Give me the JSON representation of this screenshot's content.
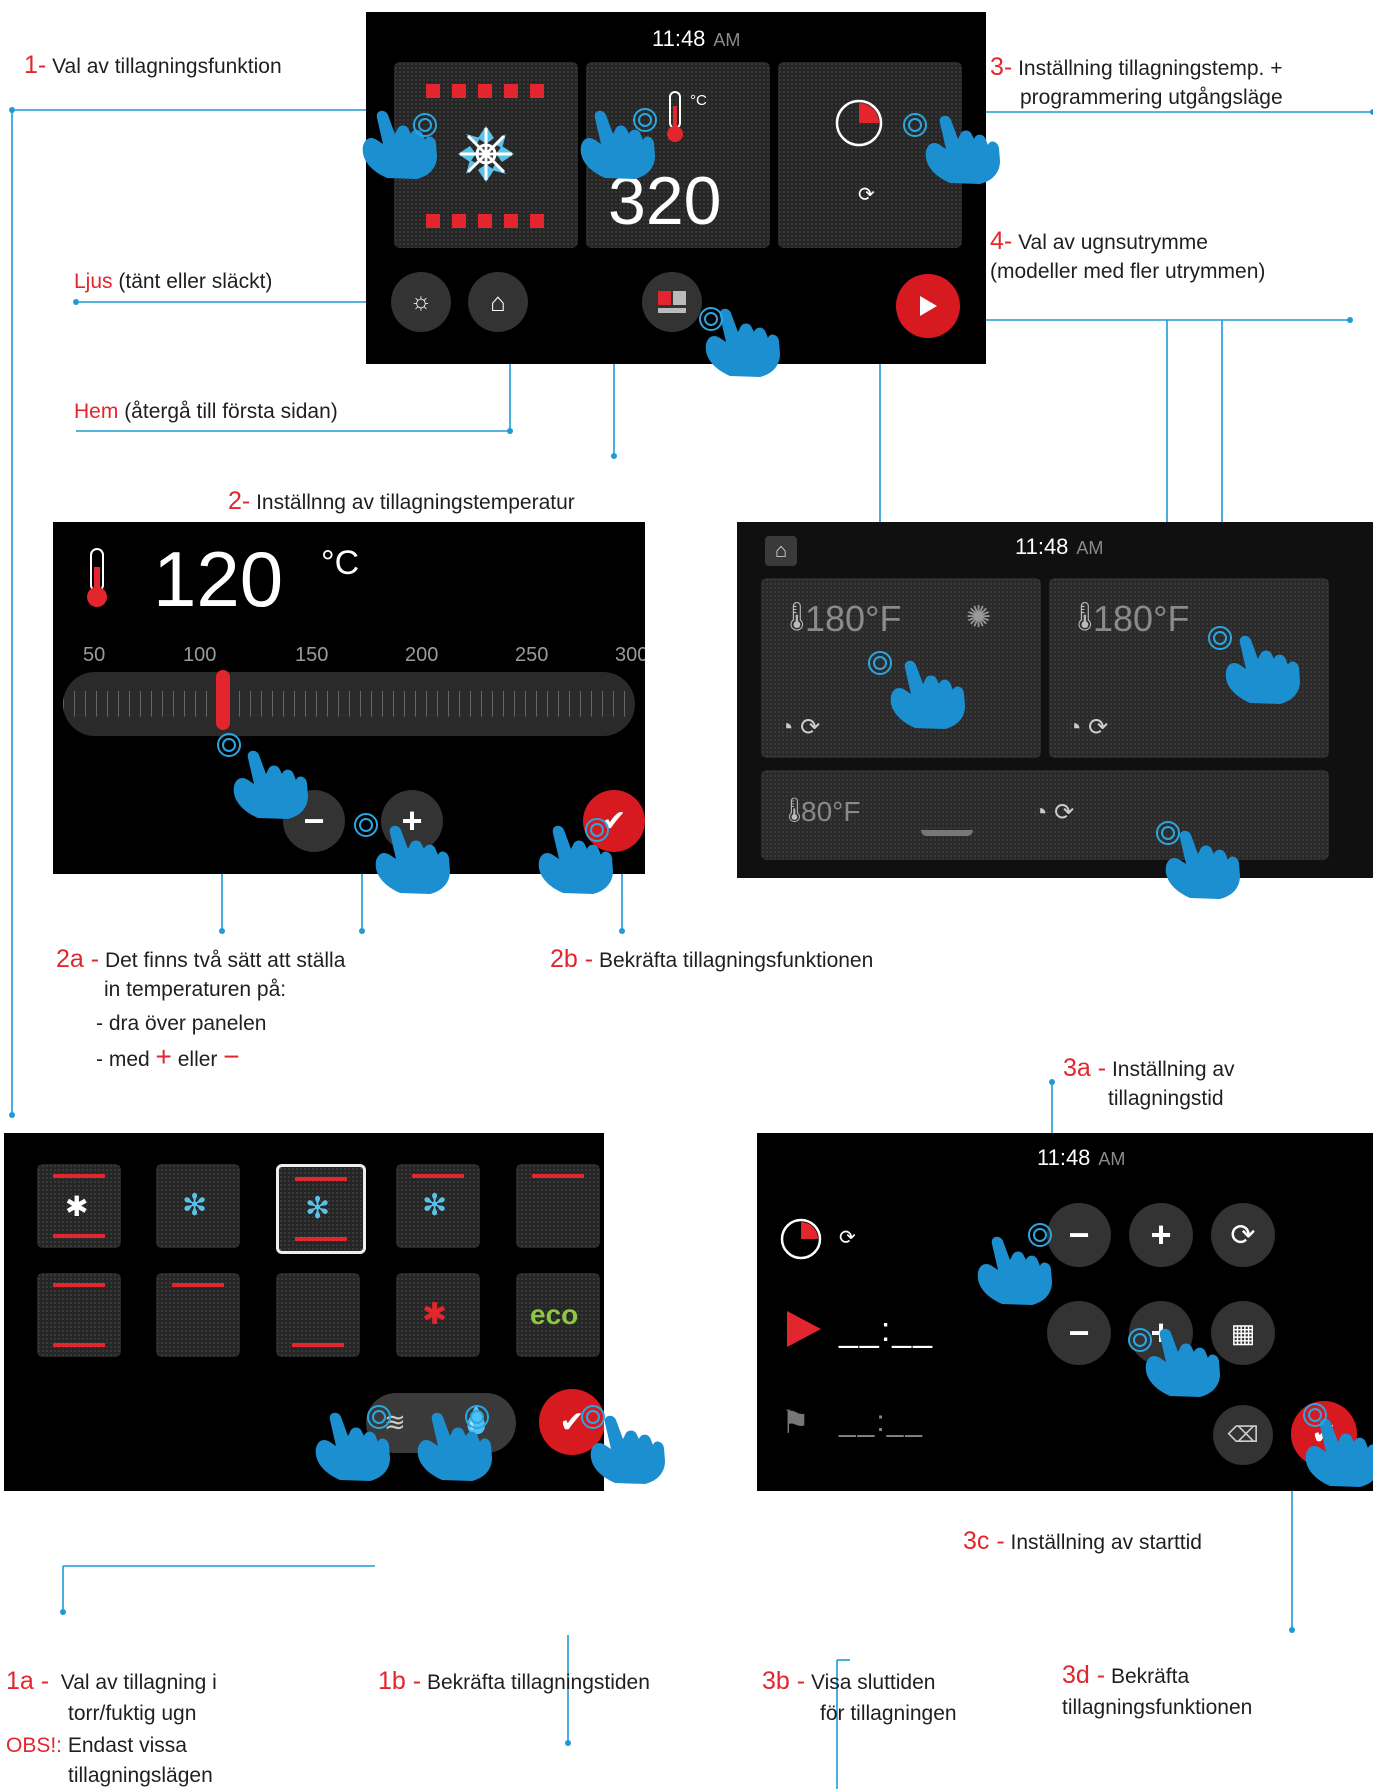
{
  "top_screen": {
    "time": "11:48",
    "ampm": "AM",
    "temperature": "320",
    "unit": "°C"
  },
  "temp_screen": {
    "value": "120",
    "unit": "°C",
    "scale": [
      "50",
      "100",
      "150",
      "200",
      "250",
      "300"
    ],
    "level_fraction": 0.28
  },
  "zones_screen": {
    "time": "11:48",
    "ampm": "AM",
    "zone1_temp": "180°F",
    "zone2_temp": "180°F",
    "zone3_temp": "80°F"
  },
  "func_screen": {
    "eco_label": "eco"
  },
  "time_screen": {
    "time": "11:48",
    "ampm": "AM",
    "start_placeholder": "__:__",
    "end_placeholder": "__:__"
  },
  "labels": {
    "l1_num": "1-",
    "l1_text": "Val av tillagningsfunktion",
    "l3_num": "3-",
    "l3_line1": "Inställning tillagningstemp. +",
    "l3_line2": "programmering utgångsläge",
    "l4_num": "4-",
    "l4_line1": "Val av ugnsutrymme",
    "l4_line2": "(modeller med fler utrymmen)",
    "ljus_red": "Ljus",
    "ljus_text": "(tänt eller släckt)",
    "hem_red": "Hem",
    "hem_text": "(återgå till första sidan)",
    "l2_num": "2-",
    "l2_text": "Inställnng av tillagningstemperatur",
    "l2a_num": "2a -",
    "l2a_line1": "Det finns två sätt att ställa",
    "l2a_line2": "in temperaturen på:",
    "l2a_line3": "- dra över panelen",
    "l2a_line4_pre": "- med",
    "l2a_plus": "+",
    "l2a_or": "eller",
    "l2a_minus": "−",
    "l2b_num": "2b -",
    "l2b_text": "Bekräfta tillagningsfunktionen",
    "l3a_num": "3a -",
    "l3a_line1": "Inställning av",
    "l3a_line2": "tillagningstid",
    "l3c_num": "3c -",
    "l3c_text": "Inställning av starttid",
    "l1a_num": "1a -",
    "l1a_line1": "Val av tillagning i",
    "l1a_line2": "torr/fuktig ugn",
    "obs_red": "OBS!:",
    "obs_line1": "Endast vissa",
    "obs_line2": "tillagningslägen",
    "l1b_num": "1b -",
    "l1b_text": "Bekräfta tillagningstiden",
    "l3b_num": "3b -",
    "l3b_line1": "Visa sluttiden",
    "l3b_line2": "för tillagningen",
    "l3d_num": "3d -",
    "l3d_line1": "Bekräfta",
    "l3d_line2": "tillagningsfunktionen"
  },
  "colors": {
    "accent_red": "#e3262d",
    "callout_blue": "#1e9ad6",
    "hand_blue": "#1c8fd0",
    "fan_blue": "#5bc2e7"
  }
}
